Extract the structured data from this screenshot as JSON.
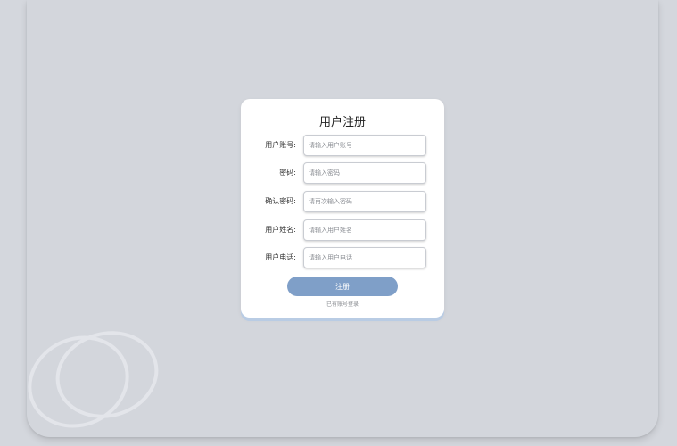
{
  "form": {
    "title": "用户注册",
    "fields": [
      {
        "label": "用户账号:",
        "placeholder": "请输入用户账号",
        "value": ""
      },
      {
        "label": "密码:",
        "placeholder": "请输入密码",
        "value": ""
      },
      {
        "label": "确认密码:",
        "placeholder": "请再次输入密码",
        "value": ""
      },
      {
        "label": "用户姓名:",
        "placeholder": "请输入用户姓名",
        "value": ""
      },
      {
        "label": "用户电话:",
        "placeholder": "请输入用户电话",
        "value": ""
      }
    ],
    "submit_label": "注册",
    "login_link": "已有账号登录"
  },
  "colors": {
    "background": "#d4d7dd",
    "card": "#ffffff",
    "button": "#7f9fc8",
    "card_shadow": "#b9cce4"
  }
}
